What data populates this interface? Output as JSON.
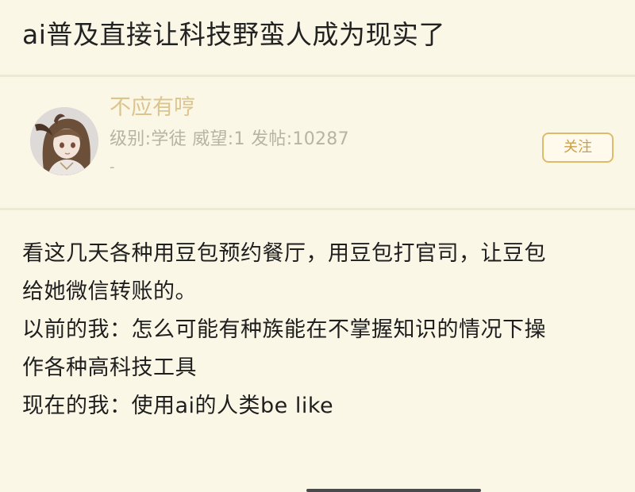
{
  "post": {
    "title": "ai普及直接让科技野蛮人成为现实了"
  },
  "author": {
    "username": "不应有哼",
    "stats": "级别:学徒  威望:1  发帖:10287",
    "extra": "-",
    "follow_label": "关注"
  },
  "content": {
    "lines": [
      "看这几天各种用豆包预约餐厅，用豆包打官司，让豆包",
      "给她微信转账的。",
      "以前的我：怎么可能有种族能在不掌握知识的情况下操",
      "作各种高科技工具",
      "现在的我：使用ai的人类be like"
    ]
  },
  "colors": {
    "background": "#fbf7e6",
    "username": "#dcc48c",
    "accent": "#dcbc6c",
    "muted_text": "#b8b3a4"
  }
}
